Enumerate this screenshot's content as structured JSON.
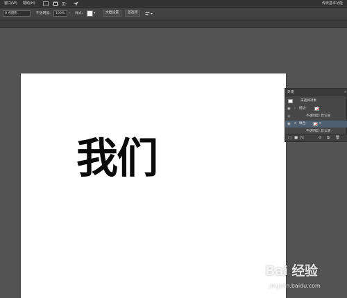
{
  "menu": {
    "window_label": "窗口(W)",
    "help_label": "帮助(H)",
    "workspace": "传统基本功能"
  },
  "control": {
    "tool_label": "8 点圆形",
    "opacity_label": "不透明度:",
    "opacity_value": "100%",
    "style_label": "样式:",
    "doc_setup_label": "文档设置",
    "prefs_label": "首选项"
  },
  "artboard": {
    "text": "我们"
  },
  "appearance_panel": {
    "tab_title": "外观",
    "rows": [
      {
        "label": "未选择对象"
      },
      {
        "label": "描边:"
      },
      {
        "label": "不透明度: 默认值"
      },
      {
        "label": "填色:"
      },
      {
        "label": "不透明度: 默认值"
      }
    ]
  },
  "watermark": {
    "logo": "Bai 经验",
    "url": "jingyan.baidu.com"
  },
  "colors": {
    "workspace_bg": "#535353",
    "menubar_bg": "#323232",
    "panel_bg": "#474747",
    "selected_row": "#4f6073",
    "artboard": "#ffffff",
    "text": "#0a0a0a"
  }
}
